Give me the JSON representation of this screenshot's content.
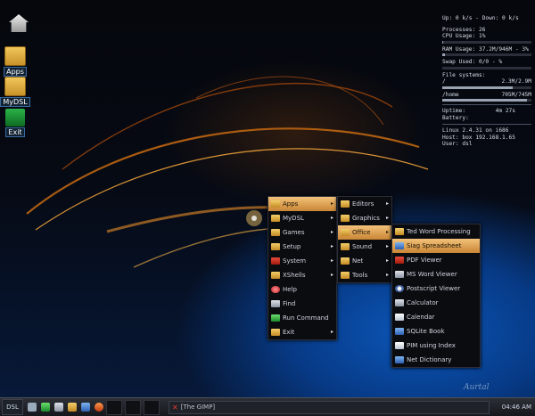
{
  "desktop": {
    "icons": [
      {
        "label": "",
        "icon": "home-icon"
      },
      {
        "label": "Apps",
        "icon": "folder-icon"
      },
      {
        "label": "MyDSL",
        "icon": "folder-icon"
      },
      {
        "label": "Exit",
        "icon": "exit-icon"
      }
    ],
    "signature": "Aurtal"
  },
  "monitor": {
    "net": "Up: 0 k/s - Down: 0 k/s",
    "processes": "Processes: 26",
    "cpu": "CPU Usage: 1%",
    "cpu_fraction": 0.01,
    "ram": "RAM Usage: 37.2M/946M - 3%",
    "ram_fraction": 0.03,
    "swap": "Swap Used: 0/0 - %",
    "swap_fraction": 0.0,
    "fs_title": "File systems:",
    "fs_root_name": "/",
    "fs_root_value": "2.3M/2.9M",
    "fs_root_fraction": 0.79,
    "fs_home_name": "/home",
    "fs_home_value": "705M/745M",
    "fs_home_fraction": 0.95,
    "uptime_label": "Uptime:",
    "uptime_value": "4m 27s",
    "battery": "Battery:",
    "linux": "Linux 2.4.31 on i686",
    "host": "Host: box 192.168.1.65",
    "user": "User: dsl"
  },
  "menu_main": [
    {
      "label": "Apps",
      "icon": "folder-icon",
      "arrow": "▸",
      "selected": true
    },
    {
      "label": "MyDSL",
      "icon": "folder-icon",
      "arrow": "▸"
    },
    {
      "label": "Games",
      "icon": "folder-icon",
      "arrow": "▸"
    },
    {
      "label": "Setup",
      "icon": "folder-icon",
      "arrow": "▸"
    },
    {
      "label": "System",
      "icon": "system-icon",
      "arrow": "▸"
    },
    {
      "label": "XShells",
      "icon": "folder-icon",
      "arrow": "▸"
    },
    {
      "label": "Help",
      "icon": "help-icon",
      "arrow": ""
    },
    {
      "label": "Find",
      "icon": "find-icon",
      "arrow": ""
    },
    {
      "label": "Run Command",
      "icon": "run-icon",
      "arrow": ""
    },
    {
      "label": "Exit",
      "icon": "folder-icon",
      "arrow": "▸"
    }
  ],
  "menu_apps": [
    {
      "label": "Editors",
      "icon": "folder-icon",
      "arrow": "▸"
    },
    {
      "label": "Graphics",
      "icon": "folder-icon",
      "arrow": "▸"
    },
    {
      "label": "Office",
      "icon": "folder-icon",
      "arrow": "▸",
      "selected": true
    },
    {
      "label": "Sound",
      "icon": "folder-icon",
      "arrow": "▸"
    },
    {
      "label": "Net",
      "icon": "folder-icon",
      "arrow": "▸"
    },
    {
      "label": "Tools",
      "icon": "folder-icon",
      "arrow": "▸"
    }
  ],
  "menu_office": [
    {
      "label": "Ted Word Processing",
      "icon": "ted-icon"
    },
    {
      "label": "Siag Spreadsheet",
      "icon": "spreadsheet-icon",
      "selected": true
    },
    {
      "label": "PDF Viewer",
      "icon": "pdf-icon"
    },
    {
      "label": "MS Word Viewer",
      "icon": "word-viewer-icon"
    },
    {
      "label": "Postscript Viewer",
      "icon": "postscript-icon"
    },
    {
      "label": "Calculator",
      "icon": "calculator-icon"
    },
    {
      "label": "Calendar",
      "icon": "calendar-icon"
    },
    {
      "label": "SQLite Book",
      "icon": "sqlite-icon"
    },
    {
      "label": "PIM using Index",
      "icon": "pim-icon"
    },
    {
      "label": "Net Dictionary",
      "icon": "dictionary-icon"
    }
  ],
  "taskbar": {
    "start_label": "DSL",
    "task_label": "[The GIMP]",
    "clock": "04:46 AM"
  }
}
